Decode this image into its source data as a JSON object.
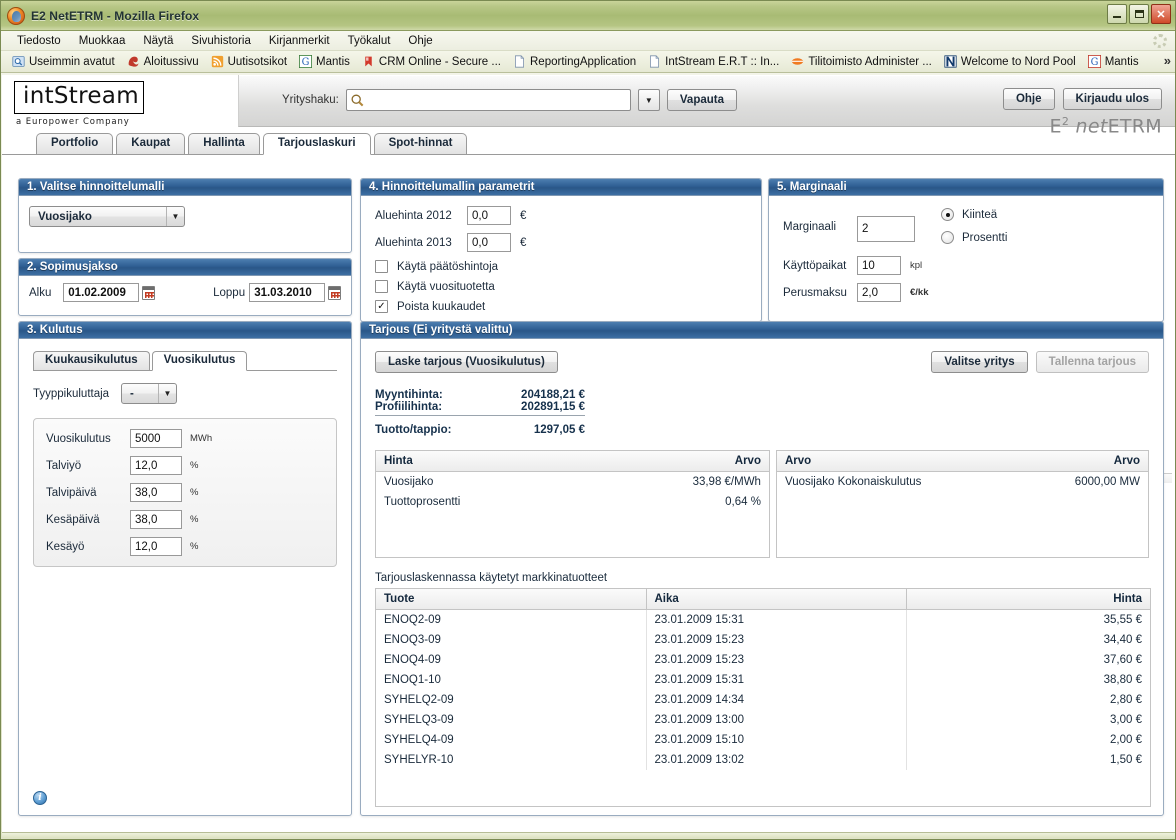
{
  "browser": {
    "title": "E2 NetETRM - Mozilla Firefox",
    "menus": [
      "Tiedosto",
      "Muokkaa",
      "Näytä",
      "Sivuhistoria",
      "Kirjanmerkit",
      "Työkalut",
      "Ohje"
    ],
    "bookmarks": [
      {
        "label": "Useimmin avatut",
        "icon": "folder-search-icon"
      },
      {
        "label": "Aloitussivu",
        "icon": "firefox-home-icon"
      },
      {
        "label": "Uutisotsikot",
        "icon": "rss-feed-icon"
      },
      {
        "label": "Mantis",
        "icon": "google-g-icon"
      },
      {
        "label": "CRM Online - Secure ...",
        "icon": "bookmark-icon"
      },
      {
        "label": "ReportingApplication",
        "icon": "page-icon"
      },
      {
        "label": "IntStream E.R.T :: In...",
        "icon": "page-icon"
      },
      {
        "label": "Tilitoimisto Administer ...",
        "icon": "orange-disc-icon"
      },
      {
        "label": "Welcome to Nord Pool",
        "icon": "nordpool-icon"
      },
      {
        "label": "Mantis",
        "icon": "google-g-icon"
      }
    ],
    "overflow_label": "»",
    "window_buttons": {
      "minimize": "minimize-button",
      "maximize": "maximize-button",
      "close": "close-button"
    }
  },
  "app": {
    "logo_text": "intStream",
    "logo_sub": "a Europower Company",
    "brand_right_prefix": "E",
    "brand_right_sup": "2",
    "brand_right_italic": "net",
    "brand_right_suffix": "ETRM",
    "search": {
      "label": "Yrityshaku:",
      "value": "",
      "placeholder": ""
    },
    "release_button": "Vapauta",
    "help_button": "Ohje",
    "logout_button": "Kirjaudu ulos",
    "tabs": [
      {
        "label": "Portfolio",
        "active": false
      },
      {
        "label": "Kaupat",
        "active": false
      },
      {
        "label": "Hallinta",
        "active": false
      },
      {
        "label": "Tarjouslaskuri",
        "active": true
      },
      {
        "label": "Spot-hinnat",
        "active": false
      }
    ]
  },
  "panel1": {
    "title": "1. Valitse hinnoittelumalli",
    "model_select_value": "Vuosijako"
  },
  "panel2": {
    "title": "2. Sopimusjakso",
    "start_label": "Alku",
    "start_value": "01.02.2009",
    "end_label": "Loppu",
    "end_value": "31.03.2010"
  },
  "panel3": {
    "title": "3. Kulutus",
    "tabs": [
      {
        "label": "Kuukausikulutus",
        "active": false
      },
      {
        "label": "Vuosikulutus",
        "active": true
      }
    ],
    "type_label": "Tyyppikuluttaja",
    "type_value": "-",
    "fields": [
      {
        "label": "Vuosikulutus",
        "value": "5000",
        "unit": "MWh"
      },
      {
        "label": "Talviyö",
        "value": "12,0",
        "unit": "%"
      },
      {
        "label": "Talvipäivä",
        "value": "38,0",
        "unit": "%"
      },
      {
        "label": "Kesäpäivä",
        "value": "38,0",
        "unit": "%"
      },
      {
        "label": "Kesäyö",
        "value": "12,0",
        "unit": "%"
      }
    ]
  },
  "panel4": {
    "title": "4. Hinnoittelumallin parametrit",
    "fields": [
      {
        "label": "Aluehinta 2012",
        "value": "0,0",
        "unit": "€"
      },
      {
        "label": "Aluehinta 2013",
        "value": "0,0",
        "unit": "€"
      }
    ],
    "checkboxes": [
      {
        "label": "Käytä päätöshintoja",
        "checked": false
      },
      {
        "label": "Käytä vuosituotetta",
        "checked": false
      },
      {
        "label": "Poista kuukaudet",
        "checked": true
      }
    ]
  },
  "panel5": {
    "title": "5. Marginaali",
    "margin_label": "Marginaali",
    "margin_value": "2",
    "radio_fixed": "Kiinteä",
    "radio_percent": "Prosentti",
    "radio_selected": "Kiinteä",
    "sites_label": "Käyttöpaikat",
    "sites_value": "10",
    "sites_unit": "kpl",
    "basefee_label": "Perusmaksu",
    "basefee_value": "2,0",
    "basefee_unit": "€/kk"
  },
  "offer": {
    "title": "Tarjous (Ei yritystä valittu)",
    "calc_button": "Laske tarjous (Vuosikulutus)",
    "select_company_button": "Valitse yritys",
    "save_button": "Tallenna tarjous",
    "summary": [
      {
        "label": "Myyntihinta:",
        "value": "204188,21 €"
      },
      {
        "label": "Profiilihinta:",
        "value": "202891,15 €"
      }
    ],
    "profit_label": "Tuotto/tappio:",
    "profit_value": "1297,05 €",
    "price_table": {
      "columns": [
        "Hinta",
        "Arvo"
      ],
      "rows": [
        [
          "Vuosijako",
          "33,98 €/MWh"
        ],
        [
          "Tuottoprosentti",
          "0,64 %"
        ]
      ]
    },
    "value_table": {
      "columns": [
        "Arvo",
        "Arvo"
      ],
      "rows": [
        [
          "Vuosijako Kokonaiskulutus",
          "6000,00 MW"
        ]
      ]
    },
    "products_caption": "Tarjouslaskennassa käytetyt markkinatuotteet",
    "products_table": {
      "columns": [
        "Tuote",
        "Aika",
        "Hinta"
      ],
      "rows": [
        [
          "ENOQ2-09",
          "23.01.2009 15:31",
          "35,55 €"
        ],
        [
          "ENOQ3-09",
          "23.01.2009 15:23",
          "34,40 €"
        ],
        [
          "ENOQ4-09",
          "23.01.2009 15:23",
          "37,60 €"
        ],
        [
          "ENOQ1-10",
          "23.01.2009 15:31",
          "38,80 €"
        ],
        [
          "SYHELQ2-09",
          "23.01.2009 14:34",
          "2,80 €"
        ],
        [
          "SYHELQ3-09",
          "23.01.2009 13:00",
          "3,00 €"
        ],
        [
          "SYHELQ4-09",
          "23.01.2009 15:10",
          "2,00 €"
        ],
        [
          "SYHELYR-10",
          "23.01.2009 13:02",
          "1,50 €"
        ]
      ]
    }
  },
  "footer": {
    "info_icon": "info-icon",
    "info_glyph": "i"
  },
  "colors": {
    "panel_header_blue": "#2f5f93",
    "window_chrome_green": "#a8bb74",
    "text_dark": "#1b2a3a"
  }
}
